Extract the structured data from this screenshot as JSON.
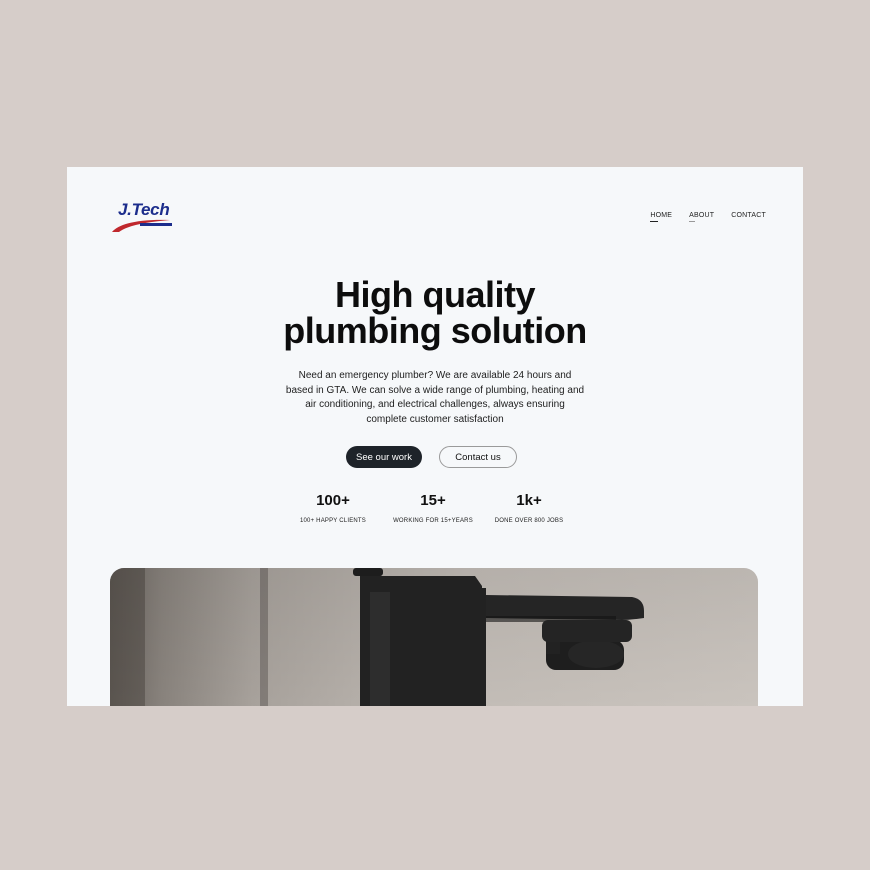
{
  "brand": {
    "name": "J.Tech"
  },
  "nav": {
    "items": [
      {
        "label": "HOME"
      },
      {
        "label": "ABOUT"
      },
      {
        "label": "CONTACT"
      }
    ]
  },
  "hero": {
    "title_line1": "High quality",
    "title_line2": "plumbing solution",
    "description_lines": [
      "Need an emergency plumber? We are available 24 hours and",
      "based in GTA. We can solve a wide range of plumbing, heating and",
      "air conditioning, and electrical challenges, always ensuring",
      "complete customer satisfaction"
    ],
    "primary_button": "See our work",
    "secondary_button": "Contact us"
  },
  "stats": [
    {
      "value": "100+",
      "label": "100+ HAPPY CLIENTS"
    },
    {
      "value": "15+",
      "label": "WORKING FOR 15+YEARS"
    },
    {
      "value": "1k+",
      "label": "DONE OVER 800 JOBS"
    }
  ],
  "colors": {
    "outer_background": "#d6cdc9",
    "page_background": "#f6f8fa",
    "primary_button": "#1e2329",
    "logo_blue": "#1c2d8c",
    "logo_red": "#c0282d"
  }
}
